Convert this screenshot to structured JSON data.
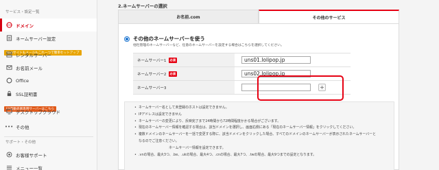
{
  "sidebar": {
    "section_title": "サービス・設定一覧",
    "items": [
      {
        "label": "ドメイン",
        "icon": "globe-icon",
        "active": true
      },
      {
        "label": "ネームサーバー設定",
        "icon": "server-icon",
        "active": false
      },
      {
        "label": "レンタルサーバー",
        "icon": "rental-server-icon",
        "active": false,
        "badge": "Webサイトもメールもこれ一つで簡単セットアップ"
      },
      {
        "label": "お名前メール",
        "icon": "mail-icon",
        "active": false
      },
      {
        "label": "Office",
        "icon": "office-icon",
        "active": false
      },
      {
        "label": "SSL証明書",
        "icon": "lock-icon",
        "active": false
      },
      {
        "label": "デスクトップクラウド",
        "icon": "desktop-icon",
        "active": false,
        "badge": "FX自動売買専用サーバーはこちら"
      },
      {
        "label": "その他",
        "icon": "more-icon",
        "active": false
      }
    ],
    "support_title": "サポート・その他",
    "support_items": [
      {
        "label": "お客様サポート",
        "icon": "support-icon"
      },
      {
        "label": "メニュー一覧",
        "icon": "menu-icon"
      }
    ]
  },
  "main": {
    "section_heading": "2.ネームサーバーの選択",
    "tabs": [
      {
        "label": "お名前.com",
        "active": false
      },
      {
        "label": "その他のサービス",
        "active": true
      }
    ],
    "option": {
      "label": "その他のネームサーバーを使う",
      "description": "他社管理のネームサーバーなど、任意のネームサーバーを設定する場合はこちらを選択してください。"
    },
    "nameservers": [
      {
        "label": "ネームサーバー1",
        "required": "必須",
        "value": "uns01.lolipop.jp"
      },
      {
        "label": "ネームサーバー2",
        "required": "必須",
        "value": "uns02.lolipop.jp"
      },
      {
        "label": "ネームサーバー3",
        "required": "",
        "value": ""
      }
    ],
    "add_button": "+",
    "notes": [
      "ネームサーバー名として未登録のホストは設定できません。",
      "IPアドレスは設定できません",
      "ネームサーバーの変更により、反映完了まで24時間から72時間程度かかる場合がございます。",
      "現在のネームサーバー情報を確認する場合は、該当ドメインを選択し、画面右側にある「現在のネームサーバー情報」をクリックしてください。",
      "複数ドメインのネームサーバーを一括で変更する際に、該当ドメインをクリックした場合、すべてのドメインのネームサーバーが表示されたネームサーバーと",
      "なるのでご注意ください。",
      "ネームサーバー情報を設定できます。",
      ".vnの場合、最大3つ、.be、.ukの場合、最大4つ、.cnの場合、最大7つ、.twの場合、最大9つまでの設定となります。"
    ]
  },
  "colors": {
    "accent_red": "#e60012",
    "radio_blue": "#1b74d0",
    "badge_orange": "#e8a400"
  }
}
